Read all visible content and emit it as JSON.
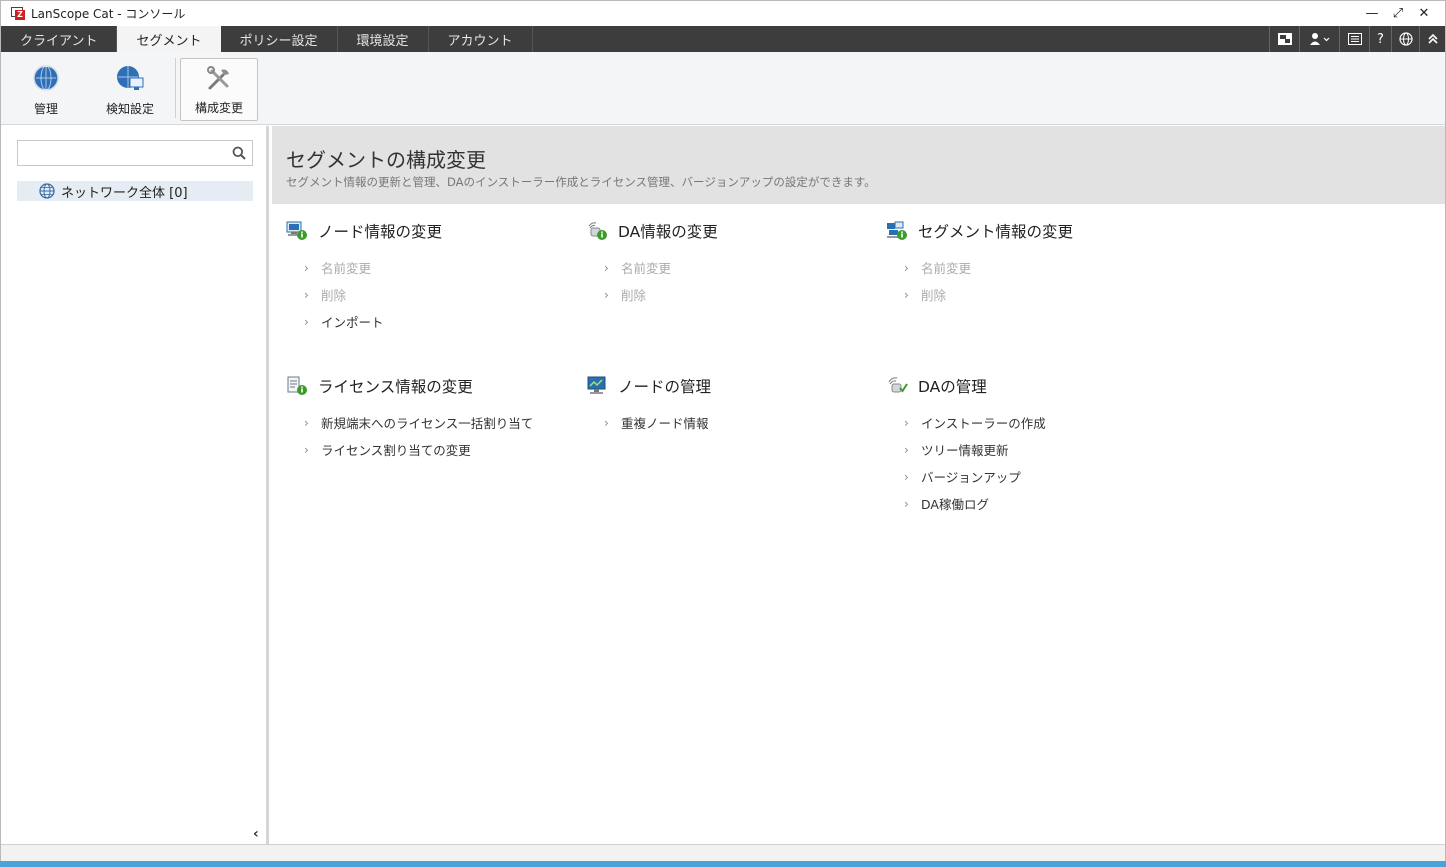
{
  "window": {
    "title": "LanScope Cat - コンソール",
    "minimize": "—",
    "maximize": "⤢",
    "close": "✕"
  },
  "tabs": [
    {
      "label": "クライアント"
    },
    {
      "label": "セグメント"
    },
    {
      "label": "ポリシー設定"
    },
    {
      "label": "環境設定"
    },
    {
      "label": "アカウント"
    }
  ],
  "tab_icons": [
    {
      "name": "remote-control-icon",
      "glyph": "▣"
    },
    {
      "name": "user-icon",
      "glyph": "👤 ⌄"
    },
    {
      "name": "list-icon",
      "glyph": "☰"
    },
    {
      "name": "help-icon",
      "glyph": "?"
    },
    {
      "name": "globe-icon",
      "glyph": "⊕"
    },
    {
      "name": "collapse-ribbon-icon",
      "glyph": "︽"
    }
  ],
  "ribbon": {
    "manage": "管理",
    "detection": "検知設定",
    "config": "構成変更"
  },
  "search": {
    "placeholder": "",
    "value": ""
  },
  "tree": {
    "root_label": "ネットワーク全体 [0]"
  },
  "main": {
    "title": "セグメントの構成変更",
    "description": "セグメント情報の更新と管理、DAのインストーラー作成とライセンス管理、バージョンアップの設定ができます。"
  },
  "sections": {
    "node_info": {
      "title": "ノード情報の変更",
      "links": [
        {
          "label": "名前変更",
          "enabled": false
        },
        {
          "label": "削除",
          "enabled": false
        },
        {
          "label": "インポート",
          "enabled": true
        }
      ]
    },
    "da_info": {
      "title": "DA情報の変更",
      "links": [
        {
          "label": "名前変更",
          "enabled": false
        },
        {
          "label": "削除",
          "enabled": false
        }
      ]
    },
    "segment_info": {
      "title": "セグメント情報の変更",
      "links": [
        {
          "label": "名前変更",
          "enabled": false
        },
        {
          "label": "削除",
          "enabled": false
        }
      ]
    },
    "license_info": {
      "title": "ライセンス情報の変更",
      "links": [
        {
          "label": "新規端末へのライセンス一括割り当て",
          "enabled": true
        },
        {
          "label": "ライセンス割り当ての変更",
          "enabled": true
        }
      ]
    },
    "node_manage": {
      "title": "ノードの管理",
      "links": [
        {
          "label": "重複ノード情報",
          "enabled": true
        }
      ]
    },
    "da_manage": {
      "title": "DAの管理",
      "links": [
        {
          "label": "インストーラーの作成",
          "enabled": true
        },
        {
          "label": "ツリー情報更新",
          "enabled": true
        },
        {
          "label": "バージョンアップ",
          "enabled": true
        },
        {
          "label": "DA稼働ログ",
          "enabled": true
        }
      ]
    }
  },
  "chevron": "›",
  "collapse_pane": "‹",
  "colors": {
    "tabbar": "#3d3d3d",
    "header_band": "#e2e2e2",
    "disabled_text": "#aaaaaa",
    "info_green": "#3c9a2a",
    "monitor_blue": "#2a6fb0"
  }
}
